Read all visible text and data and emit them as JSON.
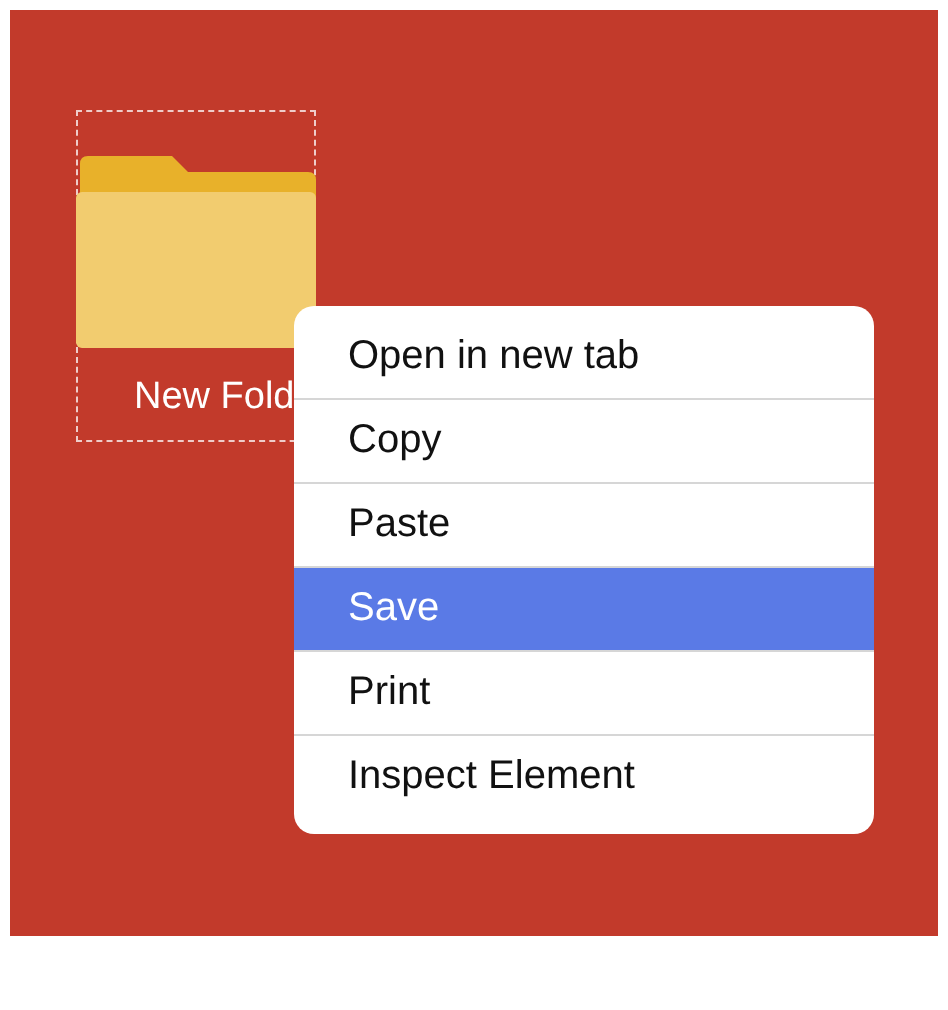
{
  "desktop": {
    "folder": {
      "label": "New Fold",
      "selected": true
    }
  },
  "context_menu": {
    "items": [
      {
        "label": "Open in new tab",
        "selected": false
      },
      {
        "label": "Copy",
        "selected": false
      },
      {
        "label": "Paste",
        "selected": false
      },
      {
        "label": "Save",
        "selected": true
      },
      {
        "label": "Print",
        "selected": false
      },
      {
        "label": "Inspect Element",
        "selected": false
      }
    ]
  }
}
